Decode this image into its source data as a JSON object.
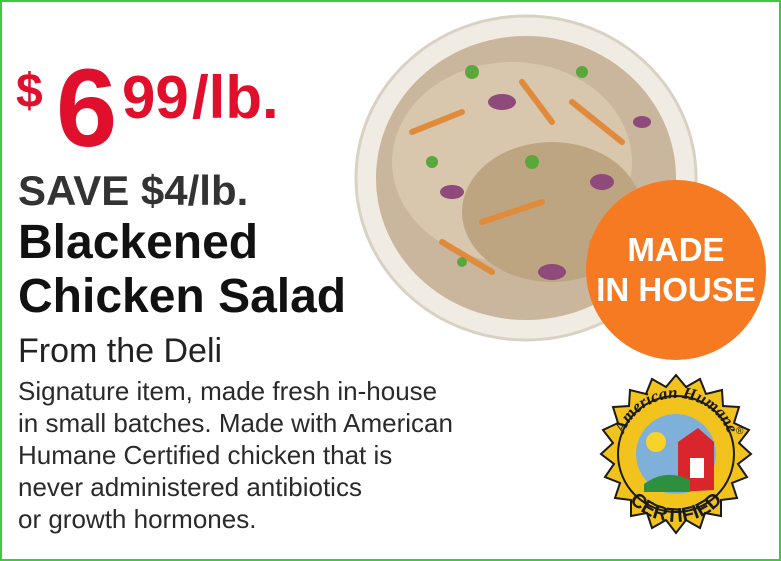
{
  "price": {
    "currency": "$",
    "dollars": "6",
    "cents": "99",
    "unit": "/lb."
  },
  "savings": "SAVE $4/lb.",
  "product": {
    "name_line1": "Blackened",
    "name_line2": "Chicken Salad",
    "subtitle": "From the Deli"
  },
  "description": [
    "Signature item, made fresh in-house",
    "in small batches. Made with American",
    "Humane Certified chicken that is",
    "never administered antibiotics",
    "or growth hormones."
  ],
  "badge": {
    "line1": "MADE",
    "line2": "IN HOUSE"
  },
  "seal": {
    "top_text": "American Humane",
    "bottom_text": "CERTIFIED",
    "registered": "®"
  },
  "colors": {
    "price": "#e0102c",
    "badge": "#f57a22",
    "seal_gold": "#f2c31c",
    "border": "#3ec93e"
  }
}
